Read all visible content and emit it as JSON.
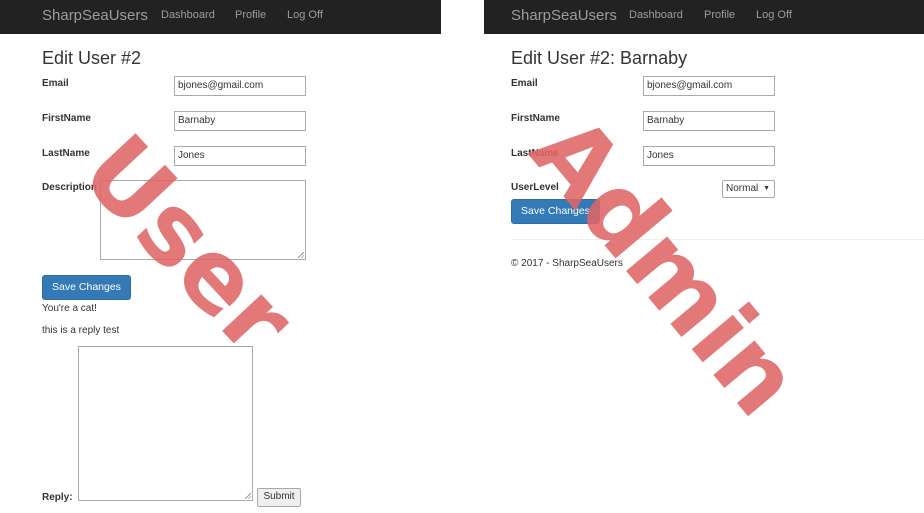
{
  "left": {
    "nav": {
      "brand": "SharpSeaUsers",
      "items": [
        "Dashboard",
        "Profile",
        "Log Off"
      ]
    },
    "title": "Edit User #2",
    "fields": {
      "email": {
        "label": "Email",
        "value": "bjones@gmail.com"
      },
      "firstname": {
        "label": "FirstName",
        "value": "Barnaby"
      },
      "lastname": {
        "label": "LastName",
        "value": "Jones"
      },
      "description": {
        "label": "Description",
        "value": ""
      }
    },
    "save_label": "Save Changes",
    "messages": [
      "You're a cat!",
      "this is a reply test"
    ],
    "reply_label": "Reply:",
    "submit_label": "Submit",
    "watermark": "User"
  },
  "right": {
    "nav": {
      "brand": "SharpSeaUsers",
      "items": [
        "Dashboard",
        "Profile",
        "Log Off"
      ]
    },
    "title": "Edit User #2: Barnaby",
    "fields": {
      "email": {
        "label": "Email",
        "value": "bjones@gmail.com"
      },
      "firstname": {
        "label": "FirstName",
        "value": "Barnaby"
      },
      "lastname": {
        "label": "LastName",
        "value": "Jones"
      },
      "userlevel": {
        "label": "UserLevel",
        "value": "Normal"
      }
    },
    "save_label": "Save Changes",
    "footer": "© 2017 - SharpSeaUsers",
    "watermark": "Admin"
  },
  "colors": {
    "navbar": "#222222",
    "nav_text": "#9d9d9d",
    "primary": "#337ab7",
    "watermark": "#e06666"
  },
  "icons": {
    "select_arrow": "caret-down-icon",
    "resize_handle": "resize-grip-icon"
  }
}
